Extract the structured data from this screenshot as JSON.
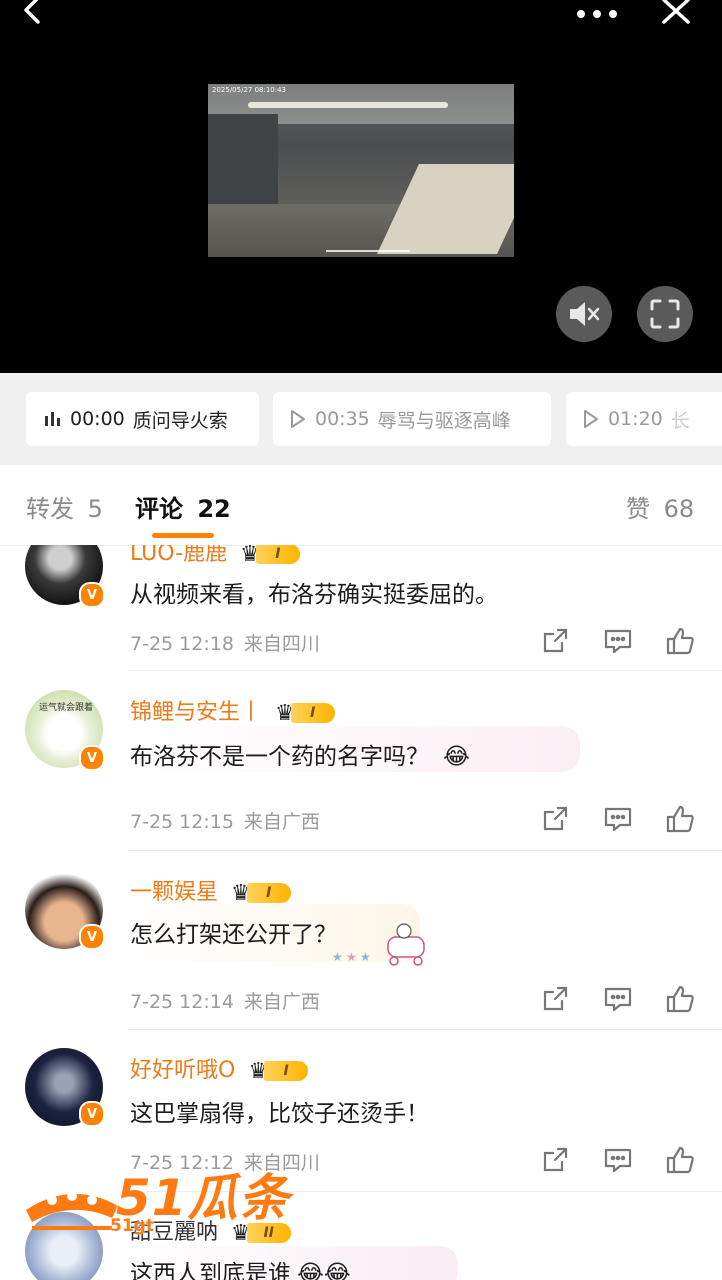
{
  "video": {
    "timestamp": "2025/05/27 08:10:43",
    "icons": {
      "back": "back-arrow-icon",
      "more": "more-dots-icon",
      "close": "close-icon",
      "mute": "mute-icon",
      "fullscreen": "fullscreen-icon"
    }
  },
  "chapters": [
    {
      "time": "00:00",
      "title": "质问导火索",
      "active": true
    },
    {
      "time": "00:35",
      "title": "辱骂与驱逐高峰",
      "active": false
    },
    {
      "time": "01:20",
      "title": "长",
      "active": false
    }
  ],
  "tabs": {
    "repost_label": "转发",
    "repost_count": "5",
    "comment_label": "评论",
    "comment_count": "22",
    "like_label": "赞",
    "like_count": "68",
    "accent": "#ff8200"
  },
  "comments": [
    {
      "user": "LUO-鹿鹿",
      "level": "I",
      "text": "从视频来看，布洛芬确实挺委屈的。",
      "date": "7-25 12:18",
      "location": "来自四川"
    },
    {
      "user": "锦鲤与安生丨",
      "level": "I",
      "text": "布洛芬不是一个药的名字吗？",
      "emoji": "😂",
      "date": "7-25 12:15",
      "location": "来自广西",
      "avatar_text": "运气就会跟着"
    },
    {
      "user": "一颗娱星",
      "level": "I",
      "text": "怎么打架还公开了？",
      "date": "7-25 12:14",
      "location": "来自广西"
    },
    {
      "user": "好好听哦O",
      "level": "I",
      "text": "这巴掌扇得，比饺子还烫手！",
      "date": "7-25 12:12",
      "location": "来自四川"
    },
    {
      "user": "甜豆麗呐",
      "level": "II",
      "text": "这西人到底是谁",
      "emoji": "😂😂"
    }
  ],
  "watermark": {
    "brand": "51瓜条",
    "domain": "51gt"
  }
}
